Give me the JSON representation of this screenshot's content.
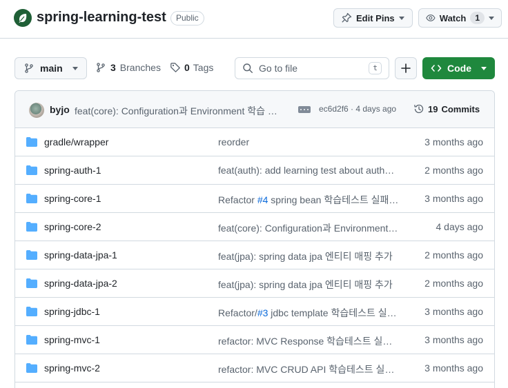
{
  "repo": {
    "name": "spring-learning-test",
    "visibility": "Public",
    "edit_pins_label": "Edit Pins",
    "watch_label": "Watch",
    "watch_count": "1"
  },
  "toolbar": {
    "branch": "main",
    "branches_count": "3",
    "branches_label": "Branches",
    "tags_count": "0",
    "tags_label": "Tags",
    "search_placeholder": "Go to file",
    "search_shortcut": "t",
    "code_label": "Code"
  },
  "latest_commit": {
    "author": "byjo",
    "message": "feat(core): Configuration과 Environment 학습 테스트 추가",
    "hash_time": "ec6d2f6 · 4 days ago",
    "commits_count": "19",
    "commits_label": "Commits"
  },
  "files": [
    {
      "name": "gradle/wrapper",
      "msg_pre": "reorder",
      "msg_link": "",
      "msg_post": "",
      "age": "3 months ago"
    },
    {
      "name": "spring-auth-1",
      "msg_pre": "feat(auth): add learning test about authentication",
      "msg_link": "",
      "msg_post": "",
      "age": "2 months ago"
    },
    {
      "name": "spring-core-1",
      "msg_pre": "Refactor ",
      "msg_link": "#4",
      "msg_post": " spring bean 학습테스트 실패하도록 수정",
      "age": "3 months ago"
    },
    {
      "name": "spring-core-2",
      "msg_pre": "feat(core): Configuration과 Environment 학습 테스트 추가",
      "msg_link": "",
      "msg_post": "",
      "age": "4 days ago"
    },
    {
      "name": "spring-data-jpa-1",
      "msg_pre": "feat(jpa): spring data jpa 엔티티 매핑 추가",
      "msg_link": "",
      "msg_post": "",
      "age": "2 months ago"
    },
    {
      "name": "spring-data-jpa-2",
      "msg_pre": "feat(jpa): spring data jpa 엔티티 매핑 추가",
      "msg_link": "",
      "msg_post": "",
      "age": "2 months ago"
    },
    {
      "name": "spring-jdbc-1",
      "msg_pre": "Refactor/",
      "msg_link": "#3",
      "msg_post": " jdbc template 학습테스트 실패하도록 수정",
      "age": "3 months ago"
    },
    {
      "name": "spring-mvc-1",
      "msg_pre": "refactor: MVC Response 학습테스트 실패하도록 수정",
      "msg_link": "",
      "msg_post": "",
      "age": "3 months ago"
    },
    {
      "name": "spring-mvc-2",
      "msg_pre": "refactor: MVC CRUD API 학습테스트 실패하도록 수정",
      "msg_link": "",
      "msg_post": "",
      "age": "3 months ago"
    }
  ]
}
